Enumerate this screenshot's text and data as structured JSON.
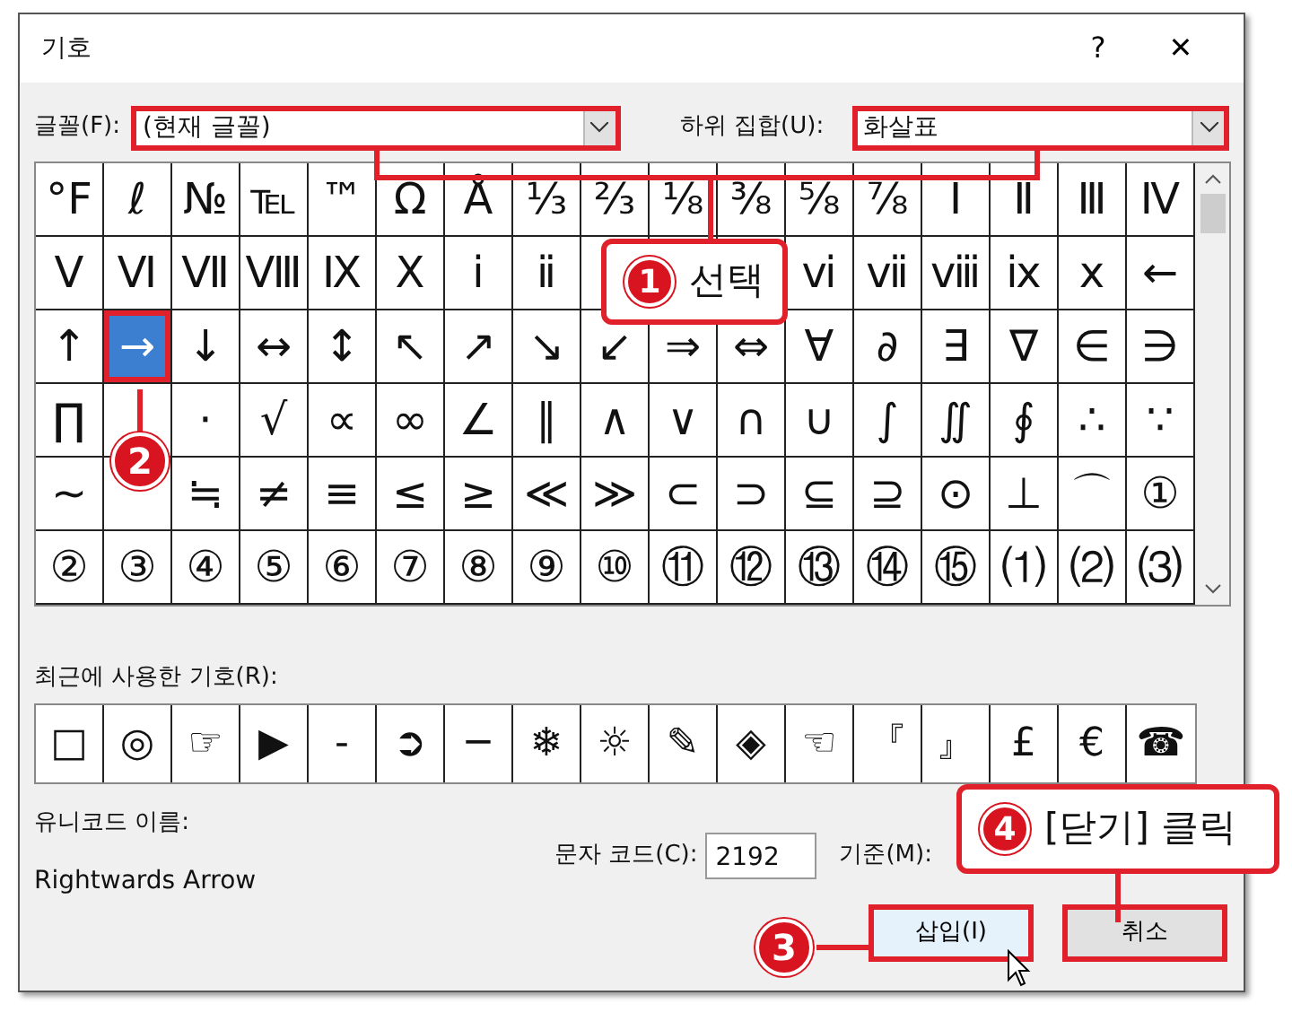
{
  "window": {
    "title": "기호",
    "help": "?",
    "close": "✕"
  },
  "font": {
    "label": "글꼴(F):",
    "value": "(현재 글꼴)",
    "highlighted": true
  },
  "subset": {
    "label": "하위 집합(U):",
    "value": "화살표",
    "highlighted": true
  },
  "symbols": [
    [
      {
        "s": "°F",
        "selected": false
      },
      {
        "s": "ℓ",
        "selected": false
      },
      {
        "s": "№",
        "selected": false
      },
      {
        "s": "℡",
        "selected": false
      },
      {
        "s": "™",
        "selected": false
      },
      {
        "s": "Ω",
        "selected": false
      },
      {
        "s": "Å",
        "selected": false
      },
      {
        "s": "⅓",
        "selected": false
      },
      {
        "s": "⅔",
        "selected": false
      },
      {
        "s": "⅛",
        "selected": false
      },
      {
        "s": "⅜",
        "selected": false
      },
      {
        "s": "⅝",
        "selected": false
      },
      {
        "s": "⅞",
        "selected": false
      },
      {
        "s": "Ⅰ",
        "selected": false
      },
      {
        "s": "Ⅱ",
        "selected": false
      },
      {
        "s": "Ⅲ",
        "selected": false
      },
      {
        "s": "Ⅳ",
        "selected": false
      }
    ],
    [
      {
        "s": "Ⅴ",
        "selected": false
      },
      {
        "s": "Ⅵ",
        "selected": false
      },
      {
        "s": "Ⅶ",
        "selected": false
      },
      {
        "s": "Ⅷ",
        "selected": false
      },
      {
        "s": "Ⅸ",
        "selected": false
      },
      {
        "s": "Ⅹ",
        "selected": false
      },
      {
        "s": "ⅰ",
        "selected": false
      },
      {
        "s": "ⅱ",
        "selected": false
      },
      {
        "selected": false
      },
      {
        "selected": false
      },
      {
        "selected": false
      },
      {
        "s": "ⅵ",
        "selected": false
      },
      {
        "s": "ⅶ",
        "selected": false
      },
      {
        "s": "ⅷ",
        "selected": false
      },
      {
        "s": "ⅸ",
        "selected": false
      },
      {
        "s": "ⅹ",
        "selected": false
      },
      {
        "s": "←",
        "selected": false
      }
    ],
    [
      {
        "s": "↑",
        "selected": false
      },
      {
        "s": "→",
        "selected": true
      },
      {
        "s": "↓",
        "selected": false
      },
      {
        "s": "↔",
        "selected": false
      },
      {
        "s": "↕",
        "selected": false
      },
      {
        "s": "↖",
        "selected": false
      },
      {
        "s": "↗",
        "selected": false
      },
      {
        "s": "↘",
        "selected": false
      },
      {
        "s": "↙",
        "selected": false
      },
      {
        "s": "⇒",
        "selected": false
      },
      {
        "s": "⇔",
        "selected": false
      },
      {
        "s": "∀",
        "selected": false
      },
      {
        "s": "∂",
        "selected": false
      },
      {
        "s": "∃",
        "selected": false
      },
      {
        "s": "∇",
        "selected": false
      },
      {
        "s": "∈",
        "selected": false
      },
      {
        "s": "∋",
        "selected": false
      }
    ],
    [
      {
        "s": "∏",
        "selected": false
      },
      {
        "selected": false
      },
      {
        "s": "·",
        "selected": false
      },
      {
        "s": "√",
        "selected": false
      },
      {
        "s": "∝",
        "selected": false
      },
      {
        "s": "∞",
        "selected": false
      },
      {
        "s": "∠",
        "selected": false
      },
      {
        "s": "∥",
        "selected": false
      },
      {
        "s": "∧",
        "selected": false
      },
      {
        "s": "∨",
        "selected": false
      },
      {
        "s": "∩",
        "selected": false
      },
      {
        "s": "∪",
        "selected": false
      },
      {
        "s": "∫",
        "selected": false
      },
      {
        "s": "∬",
        "selected": false
      },
      {
        "s": "∮",
        "selected": false
      },
      {
        "s": "∴",
        "selected": false
      },
      {
        "s": "∵",
        "selected": false
      }
    ],
    [
      {
        "s": "∼",
        "selected": false
      },
      {
        "selected": false
      },
      {
        "s": "≒",
        "selected": false
      },
      {
        "s": "≠",
        "selected": false
      },
      {
        "s": "≡",
        "selected": false
      },
      {
        "s": "≤",
        "selected": false
      },
      {
        "s": "≥",
        "selected": false
      },
      {
        "s": "≪",
        "selected": false
      },
      {
        "s": "≫",
        "selected": false
      },
      {
        "s": "⊂",
        "selected": false
      },
      {
        "s": "⊃",
        "selected": false
      },
      {
        "s": "⊆",
        "selected": false
      },
      {
        "s": "⊇",
        "selected": false
      },
      {
        "s": "⊙",
        "selected": false
      },
      {
        "s": "⊥",
        "selected": false
      },
      {
        "s": "⌒",
        "selected": false
      },
      {
        "s": "①",
        "selected": false
      }
    ],
    [
      {
        "s": "②",
        "selected": false
      },
      {
        "s": "③",
        "selected": false
      },
      {
        "s": "④",
        "selected": false
      },
      {
        "s": "⑤",
        "selected": false
      },
      {
        "s": "⑥",
        "selected": false
      },
      {
        "s": "⑦",
        "selected": false
      },
      {
        "s": "⑧",
        "selected": false
      },
      {
        "s": "⑨",
        "selected": false
      },
      {
        "s": "⑩",
        "selected": false
      },
      {
        "s": "⑪",
        "selected": false
      },
      {
        "s": "⑫",
        "selected": false
      },
      {
        "s": "⑬",
        "selected": false
      },
      {
        "s": "⑭",
        "selected": false
      },
      {
        "s": "⑮",
        "selected": false
      },
      {
        "s": "⑴",
        "selected": false
      },
      {
        "s": "⑵",
        "selected": false
      },
      {
        "s": "⑶",
        "selected": false
      }
    ]
  ],
  "recent": {
    "label": "최근에 사용한 기호(R):",
    "symbols": [
      "□",
      "◎",
      "☞",
      "▶",
      "-",
      "➲",
      "─",
      "❄",
      "☼",
      "✎",
      "◈",
      "☜",
      "『",
      "』",
      "£",
      "€",
      "☎"
    ]
  },
  "unicode_name": {
    "label": "유니코드 이름:",
    "value": "Rightwards Arrow"
  },
  "char_code": {
    "label": "문자 코드(C):",
    "value": "2192"
  },
  "basis": {
    "label": "기준(M):"
  },
  "buttons": [
    {
      "label": "삽입(I)",
      "kind": "primary",
      "highlighted": true
    },
    {
      "label": "취소",
      "kind": "normal",
      "highlighted": true
    }
  ],
  "callouts": [
    {
      "number": "1",
      "text": "선택"
    },
    {
      "number": "2"
    },
    {
      "number": "3"
    },
    {
      "number": "4",
      "text": "[닫기] 클릭"
    }
  ]
}
